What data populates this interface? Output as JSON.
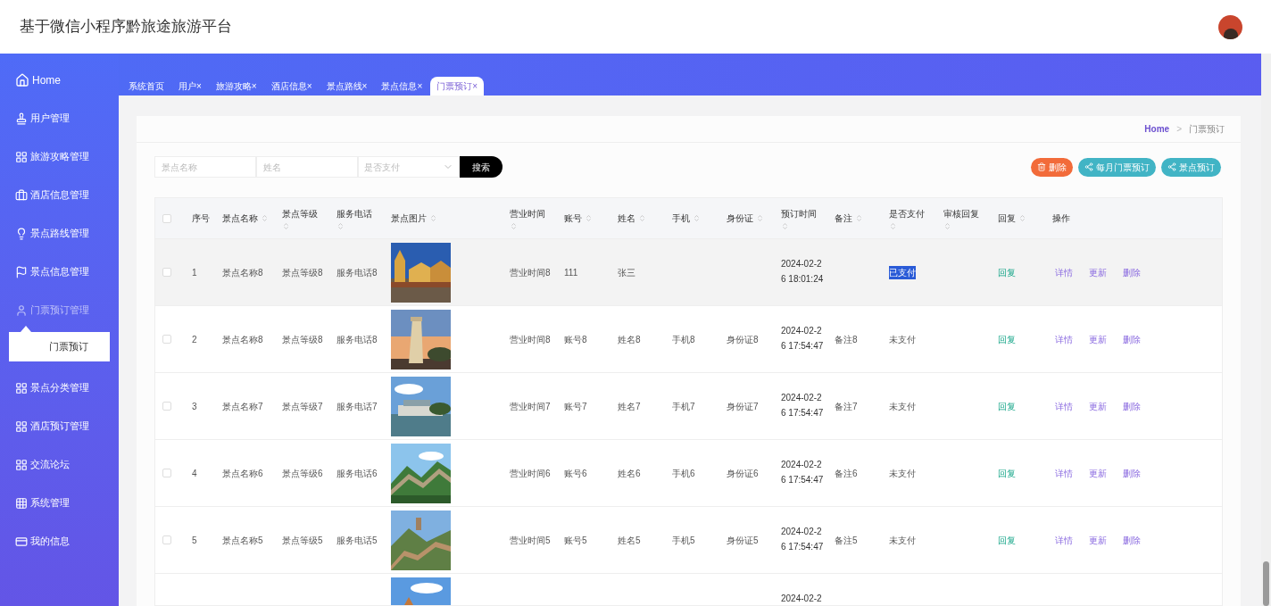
{
  "header": {
    "title": "基于微信小程序黔旅途旅游平台"
  },
  "sidebar": {
    "items": [
      {
        "label": "Home",
        "expanded": false
      },
      {
        "label": "用户管理",
        "expanded": false
      },
      {
        "label": "旅游攻略管理",
        "expanded": false
      },
      {
        "label": "酒店信息管理",
        "expanded": false
      },
      {
        "label": "景点路线管理",
        "expanded": false
      },
      {
        "label": "景点信息管理",
        "expanded": false
      },
      {
        "label": "门票预订管理",
        "expanded": true,
        "children": [
          {
            "label": "门票预订"
          }
        ]
      },
      {
        "label": "景点分类管理",
        "expanded": false
      },
      {
        "label": "酒店预订管理",
        "expanded": false
      },
      {
        "label": "交流论坛",
        "expanded": false
      },
      {
        "label": "系统管理",
        "expanded": false
      },
      {
        "label": "我的信息",
        "expanded": false
      }
    ]
  },
  "tabs": [
    {
      "label": "系统首页",
      "selected": false
    },
    {
      "label": "用户",
      "close": "×",
      "selected": false
    },
    {
      "label": "旅游攻略",
      "close": "×",
      "selected": false
    },
    {
      "label": "酒店信息",
      "close": "×",
      "selected": false
    },
    {
      "label": "景点路线",
      "close": "×",
      "selected": false
    },
    {
      "label": "景点信息",
      "close": "×",
      "selected": false
    },
    {
      "label": "门票预订",
      "close": "×",
      "selected": true
    }
  ],
  "breadcrumb": {
    "home": "Home",
    "separator": ">",
    "current": "门票预订"
  },
  "search": {
    "fields": [
      {
        "kind": "input",
        "placeholder": "景点名称"
      },
      {
        "kind": "input",
        "placeholder": "姓名"
      },
      {
        "kind": "select",
        "placeholder": "是否支付"
      }
    ],
    "button": "搜索"
  },
  "actions": [
    {
      "kind": "danger",
      "label": "删除"
    },
    {
      "kind": "share",
      "label": "每月门票预订"
    },
    {
      "kind": "share",
      "label": "景点预订"
    }
  ],
  "table": {
    "columns": [
      {
        "kind": "checkbox",
        "checked": false
      },
      {
        "label": "序号",
        "sortable": false
      },
      {
        "label": "景点名称",
        "sortable": true
      },
      {
        "label": "景点等级",
        "sortable": true
      },
      {
        "label": "服务电话",
        "sortable": true
      },
      {
        "label": "景点图片",
        "sortable": true
      },
      {
        "label": "营业时间",
        "sortable": true
      },
      {
        "label": "账号",
        "sortable": true
      },
      {
        "label": "姓名",
        "sortable": true
      },
      {
        "label": "手机",
        "sortable": true
      },
      {
        "label": "身份证",
        "sortable": true
      },
      {
        "label": "预订时间",
        "sortable": true
      },
      {
        "label": "备注",
        "sortable": true
      },
      {
        "label": "是否支付",
        "sortable": true
      },
      {
        "label": "审核回复",
        "sortable": true
      },
      {
        "label": "回复",
        "sortable": true
      },
      {
        "label": "操作",
        "sortable": false
      }
    ],
    "rows": [
      {
        "hovered": true,
        "checked": false,
        "index": "1",
        "name": "景点名称8",
        "level": "景点等级8",
        "phone": "服务电话8",
        "hours": "营业时间8",
        "account": "111",
        "person": "张三",
        "time": "2024-02-26 18:01:24",
        "paid": "已支付",
        "paid_highlighted": true,
        "reply": "回复",
        "ops": [
          "详情",
          "更新",
          "删除"
        ]
      },
      {
        "hovered": false,
        "checked": false,
        "index": "2",
        "name": "景点名称8",
        "level": "景点等级8",
        "phone": "服务电话8",
        "hours": "营业时间8",
        "account": "账号8",
        "person": "姓名8",
        "mobile": "手机8",
        "idcard": "身份证8",
        "time": "2024-02-26 17:54:47",
        "note": "备注8",
        "paid": "未支付",
        "paid_highlighted": false,
        "reply": "回复",
        "ops": [
          "详情",
          "更新",
          "删除"
        ]
      },
      {
        "hovered": false,
        "checked": false,
        "index": "3",
        "name": "景点名称7",
        "level": "景点等级7",
        "phone": "服务电话7",
        "hours": "营业时间7",
        "account": "账号7",
        "person": "姓名7",
        "mobile": "手机7",
        "idcard": "身份证7",
        "time": "2024-02-26 17:54:47",
        "note": "备注7",
        "paid": "未支付",
        "paid_highlighted": false,
        "reply": "回复",
        "ops": [
          "详情",
          "更新",
          "删除"
        ]
      },
      {
        "hovered": false,
        "checked": false,
        "index": "4",
        "name": "景点名称6",
        "level": "景点等级6",
        "phone": "服务电话6",
        "hours": "营业时间6",
        "account": "账号6",
        "person": "姓名6",
        "mobile": "手机6",
        "idcard": "身份证6",
        "time": "2024-02-26 17:54:47",
        "note": "备注6",
        "paid": "未支付",
        "paid_highlighted": false,
        "reply": "回复",
        "ops": [
          "详情",
          "更新",
          "删除"
        ]
      },
      {
        "hovered": false,
        "checked": false,
        "index": "5",
        "name": "景点名称5",
        "level": "景点等级5",
        "phone": "服务电话5",
        "hours": "营业时间5",
        "account": "账号5",
        "person": "姓名5",
        "mobile": "手机5",
        "idcard": "身份证5",
        "time": "2024-02-26 17:54:47",
        "note": "备注5",
        "paid": "未支付",
        "paid_highlighted": false,
        "reply": "回复",
        "ops": [
          "详情",
          "更新",
          "删除"
        ]
      },
      {
        "hovered": false,
        "time": "2024-02-2"
      }
    ]
  }
}
